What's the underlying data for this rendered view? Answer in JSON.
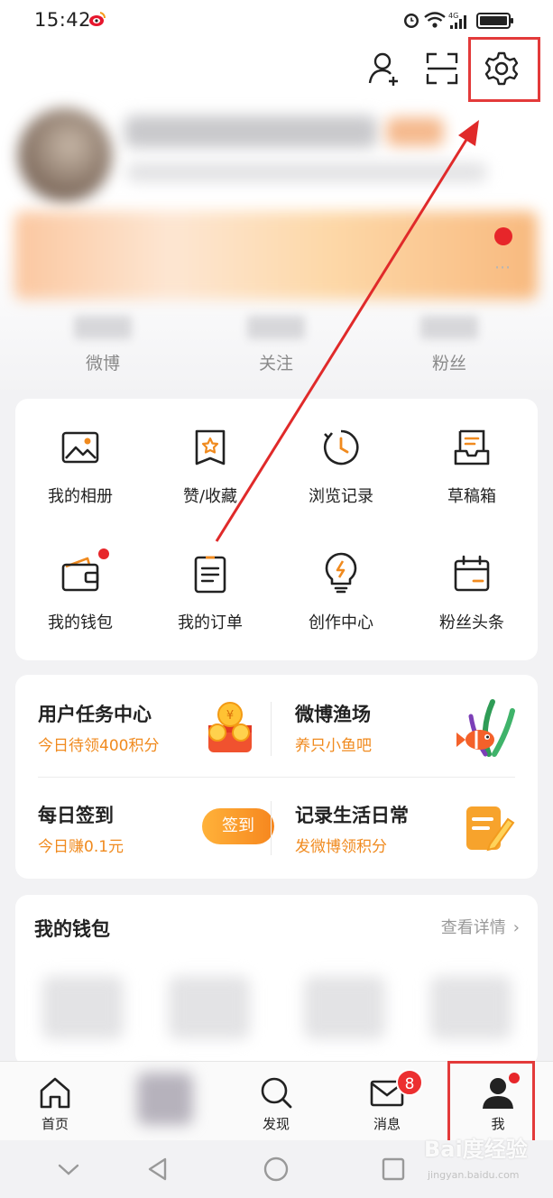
{
  "status_bar": {
    "time": "15:42",
    "network_label": "4G"
  },
  "toolbar": {
    "add_friend_icon": "add-user-icon",
    "scan_icon": "scan-icon",
    "settings_icon": "gear-icon"
  },
  "stats": [
    {
      "label": "微博"
    },
    {
      "label": "关注"
    },
    {
      "label": "粉丝"
    }
  ],
  "grid": {
    "items": [
      {
        "label": "我的相册",
        "icon": "photo-icon"
      },
      {
        "label": "赞/收藏",
        "icon": "favorite-icon"
      },
      {
        "label": "浏览记录",
        "icon": "history-icon"
      },
      {
        "label": "草稿箱",
        "icon": "drafts-icon"
      },
      {
        "label": "我的钱包",
        "icon": "wallet-icon"
      },
      {
        "label": "我的订单",
        "icon": "order-icon"
      },
      {
        "label": "创作中心",
        "icon": "creator-icon"
      },
      {
        "label": "粉丝头条",
        "icon": "calendar-icon"
      }
    ]
  },
  "tasks": {
    "task_center": {
      "title": "用户任务中心",
      "subtitle": "今日待领400积分"
    },
    "fishing": {
      "title": "微博渔场",
      "subtitle": "养只小鱼吧"
    },
    "checkin": {
      "title": "每日签到",
      "subtitle": "今日赚0.1元",
      "button": "签到"
    },
    "life_record": {
      "title": "记录生活日常",
      "subtitle": "发微博领积分"
    }
  },
  "wallet": {
    "title": "我的钱包",
    "more": "查看详情"
  },
  "bottom_nav": [
    {
      "label": "首页"
    },
    {
      "label": "发现"
    },
    {
      "label": "消息",
      "badge": "8"
    },
    {
      "label": "我"
    }
  ],
  "watermark": {
    "brand": "Bai度经验",
    "url": "jingyan.baidu.com"
  },
  "colors": {
    "accent_orange": "#f08a1e",
    "annotation_red": "#e33a3a",
    "badge_red": "#ec2f30"
  }
}
